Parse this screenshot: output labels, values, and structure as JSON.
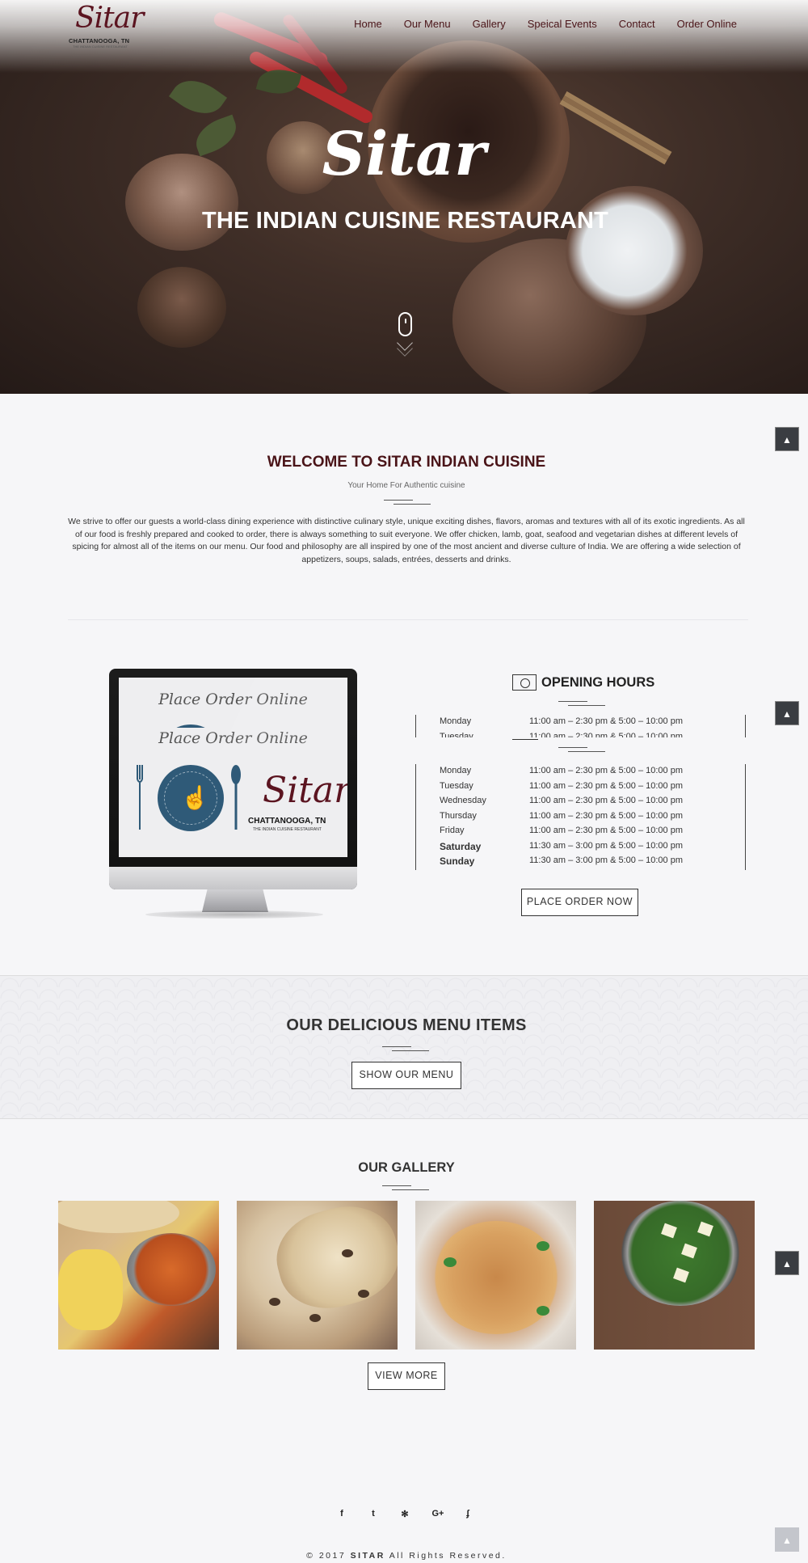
{
  "brand": {
    "logo_script": "Sitar",
    "logo_city": "CHATTANOOGA, TN",
    "logo_sub": "THE INDIAN CUISINE RESTAURANT"
  },
  "nav": {
    "items": [
      "Home",
      "Our Menu",
      "Gallery",
      "Speical Events",
      "Contact",
      "Order Online"
    ]
  },
  "hero": {
    "title": "Sitar",
    "subtitle": "THE INDIAN CUISINE RESTAURANT",
    "scroll_icon": "mouse-scroll-icon"
  },
  "back_to_top": {
    "icon": "arrow-up-icon",
    "label": "▲"
  },
  "welcome": {
    "title": "WELCOME TO SITAR INDIAN CUISINE",
    "subtitle": "Your Home For Authentic cuisine",
    "text": "We strive to offer our guests a world-class dining experience with distinctive culinary style, unique exciting dishes, flavors, aromas and textures with all of its exotic ingredients. As all of our food is freshly prepared and cooked to order, there is always something to suit everyone. We offer chicken, lamb, goat, seafood and vegetarian dishes at different levels of spicing for almost all of the items on our menu. Our food and philosophy are all inspired by one of the most ancient and diverse culture of India. We are offering a wide selection of appetizers, soups, salads, entrées, desserts and drinks."
  },
  "promo": {
    "heading": "Place Order Online",
    "city": "CHATTANOOGA, TN",
    "sub": "THE INDIAN CUISINE RESTAURANT",
    "script": "Sitar"
  },
  "hours": {
    "title": "OPENING HOURS",
    "icon": "clock-icon",
    "rows": [
      {
        "day": "Monday",
        "time": "11:00 am – 2:30 pm & 5:00 – 10:00 pm"
      },
      {
        "day": "Tuesday",
        "time": "11:00 am – 2:30 pm & 5:00 – 10:00 pm"
      },
      {
        "day": "Wednesday",
        "time": "11:00 am – 2:30 pm & 5:00 – 10:00 pm"
      },
      {
        "day": "Thursday",
        "time": "11:00 am – 2:30 pm & 5:00 – 10:00 pm"
      },
      {
        "day": "Friday",
        "time": "11:00 am – 2:30 pm & 5:00 – 10:00 pm"
      },
      {
        "day": "Saturday",
        "time": "11:30 am – 3:00 pm & 5:00 – 10:00 pm"
      },
      {
        "day": "Sunday",
        "time": "11:30 am – 3:00 pm & 5:00 – 10:00 pm"
      }
    ],
    "button": "PLACE ORDER NOW"
  },
  "menu": {
    "title": "OUR DELICIOUS MENU ITEMS",
    "button": "SHOW OUR MENU"
  },
  "gallery": {
    "title": "OUR GALLERY",
    "button": "VIEW MORE",
    "images": [
      "rice-and-curry-photo",
      "naan-bread-photo",
      "biryani-photo",
      "palak-paneer-photo"
    ]
  },
  "footer": {
    "social": [
      {
        "icon": "facebook-icon",
        "glyph": "f"
      },
      {
        "icon": "twitter-icon",
        "glyph": "t"
      },
      {
        "icon": "yelp-icon",
        "glyph": "✻"
      },
      {
        "icon": "google-plus-icon",
        "glyph": "G+"
      },
      {
        "icon": "foursquare-icon",
        "glyph": "ʄ"
      }
    ],
    "copyright_prefix": "© 2017",
    "copyright_brand": "SITAR",
    "copyright_suffix": "All Rights Reserved."
  }
}
